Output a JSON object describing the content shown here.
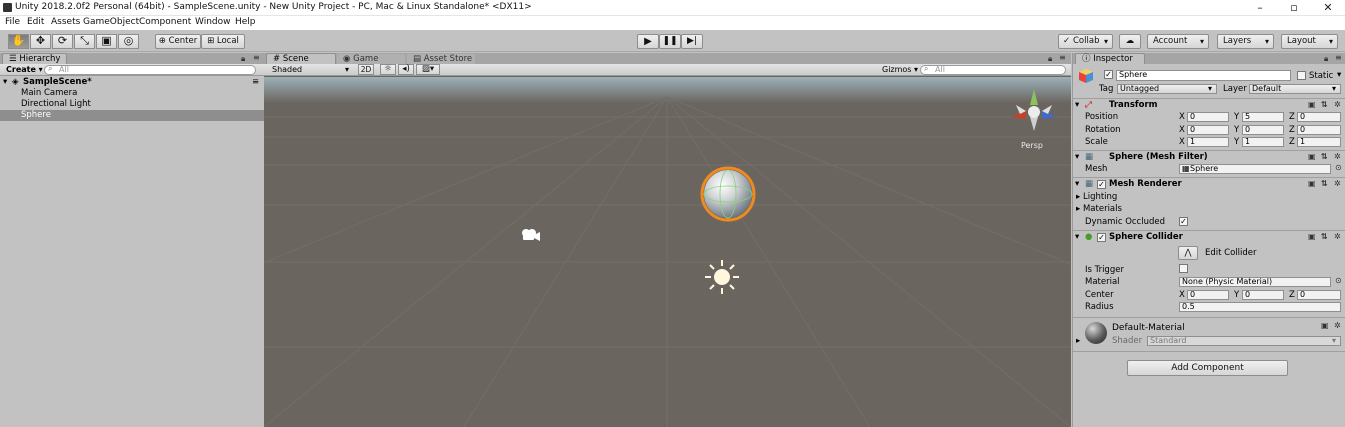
{
  "window": {
    "title": "Unity 2018.2.0f2 Personal (64bit) - SampleScene.unity - New Unity Project - PC, Mac & Linux Standalone* <DX11>"
  },
  "menu": [
    "File",
    "Edit",
    "Assets",
    "GameObject",
    "Component",
    "Window",
    "Help"
  ],
  "toolbar": {
    "tools": [
      "hand-tool-icon",
      "move-tool-icon",
      "rotate-tool-icon",
      "scale-tool-icon",
      "rect-tool-icon",
      "transform-tool-icon"
    ],
    "pivot_label": "Center",
    "space_label": "Local",
    "collab_label": "Collab",
    "account_label": "Account",
    "layers_label": "Layers",
    "layout_label": "Layout"
  },
  "hierarchy": {
    "tab": "Hierarchy",
    "create_label": "Create",
    "search_placeholder": "All",
    "scene_name": "SampleScene*",
    "items": [
      "Main Camera",
      "Directional Light",
      "Sphere"
    ],
    "selected": "Sphere"
  },
  "scene": {
    "tabs": [
      "Scene",
      "Game",
      "Asset Store"
    ],
    "shading": "Shaded",
    "mode_2d": "2D",
    "gizmos_label": "Gizmos",
    "search_placeholder": "All",
    "persp_label": "Persp"
  },
  "inspector": {
    "tab": "Inspector",
    "object_name": "Sphere",
    "static_label": "Static",
    "tag_label": "Tag",
    "tag_value": "Untagged",
    "layer_label": "Layer",
    "layer_value": "Default",
    "transform": {
      "title": "Transform",
      "position_label": "Position",
      "rotation_label": "Rotation",
      "scale_label": "Scale",
      "position": [
        "0",
        "5",
        "0"
      ],
      "rotation": [
        "0",
        "0",
        "0"
      ],
      "scale": [
        "1",
        "1",
        "1"
      ]
    },
    "mesh_filter": {
      "title": "Sphere (Mesh Filter)",
      "mesh_label": "Mesh",
      "mesh_value": "Sphere"
    },
    "mesh_renderer": {
      "title": "Mesh Renderer",
      "lighting_label": "Lighting",
      "materials_label": "Materials",
      "dyn_label": "Dynamic Occluded"
    },
    "sphere_collider": {
      "title": "Sphere Collider",
      "edit_label": "Edit Collider",
      "trigger_label": "Is Trigger",
      "material_label": "Material",
      "material_value": "None (Physic Material)",
      "center_label": "Center",
      "center": [
        "0",
        "0",
        "0"
      ],
      "radius_label": "Radius",
      "radius": "0.5"
    },
    "material": {
      "name": "Default-Material",
      "shader_label": "Shader",
      "shader_value": "Standard"
    },
    "add_component_label": "Add Component"
  },
  "axis_labels": [
    "X",
    "Y",
    "Z"
  ]
}
